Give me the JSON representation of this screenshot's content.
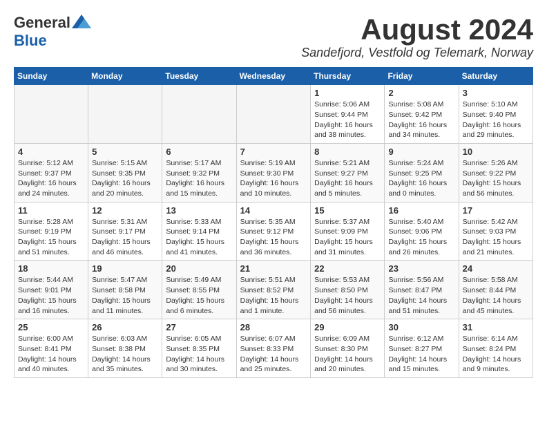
{
  "header": {
    "logo": {
      "general": "General",
      "blue": "Blue"
    },
    "title": "August 2024",
    "location": "Sandefjord, Vestfold og Telemark, Norway"
  },
  "weekdays": [
    "Sunday",
    "Monday",
    "Tuesday",
    "Wednesday",
    "Thursday",
    "Friday",
    "Saturday"
  ],
  "weeks": [
    [
      {
        "empty": true
      },
      {
        "empty": true
      },
      {
        "empty": true
      },
      {
        "empty": true
      },
      {
        "day": 1,
        "sunrise": "5:06 AM",
        "sunset": "9:44 PM",
        "daylight": "16 hours and 38 minutes."
      },
      {
        "day": 2,
        "sunrise": "5:08 AM",
        "sunset": "9:42 PM",
        "daylight": "16 hours and 34 minutes."
      },
      {
        "day": 3,
        "sunrise": "5:10 AM",
        "sunset": "9:40 PM",
        "daylight": "16 hours and 29 minutes."
      }
    ],
    [
      {
        "day": 4,
        "sunrise": "5:12 AM",
        "sunset": "9:37 PM",
        "daylight": "16 hours and 24 minutes."
      },
      {
        "day": 5,
        "sunrise": "5:15 AM",
        "sunset": "9:35 PM",
        "daylight": "16 hours and 20 minutes."
      },
      {
        "day": 6,
        "sunrise": "5:17 AM",
        "sunset": "9:32 PM",
        "daylight": "16 hours and 15 minutes."
      },
      {
        "day": 7,
        "sunrise": "5:19 AM",
        "sunset": "9:30 PM",
        "daylight": "16 hours and 10 minutes."
      },
      {
        "day": 8,
        "sunrise": "5:21 AM",
        "sunset": "9:27 PM",
        "daylight": "16 hours and 5 minutes."
      },
      {
        "day": 9,
        "sunrise": "5:24 AM",
        "sunset": "9:25 PM",
        "daylight": "16 hours and 0 minutes."
      },
      {
        "day": 10,
        "sunrise": "5:26 AM",
        "sunset": "9:22 PM",
        "daylight": "15 hours and 56 minutes."
      }
    ],
    [
      {
        "day": 11,
        "sunrise": "5:28 AM",
        "sunset": "9:19 PM",
        "daylight": "15 hours and 51 minutes."
      },
      {
        "day": 12,
        "sunrise": "5:31 AM",
        "sunset": "9:17 PM",
        "daylight": "15 hours and 46 minutes."
      },
      {
        "day": 13,
        "sunrise": "5:33 AM",
        "sunset": "9:14 PM",
        "daylight": "15 hours and 41 minutes."
      },
      {
        "day": 14,
        "sunrise": "5:35 AM",
        "sunset": "9:12 PM",
        "daylight": "15 hours and 36 minutes."
      },
      {
        "day": 15,
        "sunrise": "5:37 AM",
        "sunset": "9:09 PM",
        "daylight": "15 hours and 31 minutes."
      },
      {
        "day": 16,
        "sunrise": "5:40 AM",
        "sunset": "9:06 PM",
        "daylight": "15 hours and 26 minutes."
      },
      {
        "day": 17,
        "sunrise": "5:42 AM",
        "sunset": "9:03 PM",
        "daylight": "15 hours and 21 minutes."
      }
    ],
    [
      {
        "day": 18,
        "sunrise": "5:44 AM",
        "sunset": "9:01 PM",
        "daylight": "15 hours and 16 minutes."
      },
      {
        "day": 19,
        "sunrise": "5:47 AM",
        "sunset": "8:58 PM",
        "daylight": "15 hours and 11 minutes."
      },
      {
        "day": 20,
        "sunrise": "5:49 AM",
        "sunset": "8:55 PM",
        "daylight": "15 hours and 6 minutes."
      },
      {
        "day": 21,
        "sunrise": "5:51 AM",
        "sunset": "8:52 PM",
        "daylight": "15 hours and 1 minute."
      },
      {
        "day": 22,
        "sunrise": "5:53 AM",
        "sunset": "8:50 PM",
        "daylight": "14 hours and 56 minutes."
      },
      {
        "day": 23,
        "sunrise": "5:56 AM",
        "sunset": "8:47 PM",
        "daylight": "14 hours and 51 minutes."
      },
      {
        "day": 24,
        "sunrise": "5:58 AM",
        "sunset": "8:44 PM",
        "daylight": "14 hours and 45 minutes."
      }
    ],
    [
      {
        "day": 25,
        "sunrise": "6:00 AM",
        "sunset": "8:41 PM",
        "daylight": "14 hours and 40 minutes."
      },
      {
        "day": 26,
        "sunrise": "6:03 AM",
        "sunset": "8:38 PM",
        "daylight": "14 hours and 35 minutes."
      },
      {
        "day": 27,
        "sunrise": "6:05 AM",
        "sunset": "8:35 PM",
        "daylight": "14 hours and 30 minutes."
      },
      {
        "day": 28,
        "sunrise": "6:07 AM",
        "sunset": "8:33 PM",
        "daylight": "14 hours and 25 minutes."
      },
      {
        "day": 29,
        "sunrise": "6:09 AM",
        "sunset": "8:30 PM",
        "daylight": "14 hours and 20 minutes."
      },
      {
        "day": 30,
        "sunrise": "6:12 AM",
        "sunset": "8:27 PM",
        "daylight": "14 hours and 15 minutes."
      },
      {
        "day": 31,
        "sunrise": "6:14 AM",
        "sunset": "8:24 PM",
        "daylight": "14 hours and 9 minutes."
      }
    ]
  ]
}
